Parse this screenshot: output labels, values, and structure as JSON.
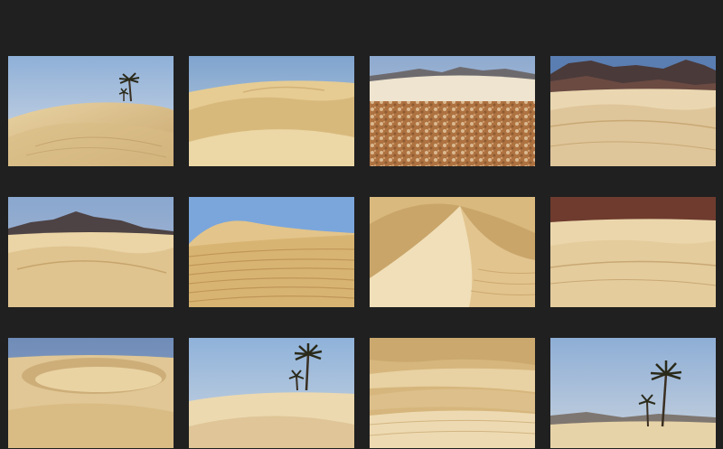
{
  "theme": {
    "background": "#202020"
  },
  "gallery": {
    "photos": [
      {
        "id": "p1",
        "scene": "dunes-with-palm-trees"
      },
      {
        "id": "p2",
        "scene": "sand-dunes"
      },
      {
        "id": "p3",
        "scene": "rocky-desert-with-mountains"
      },
      {
        "id": "p4",
        "scene": "dunes-before-dark-mountains"
      },
      {
        "id": "p5",
        "scene": "dunes-before-mountains"
      },
      {
        "id": "p6",
        "scene": "rippled-dune-crest"
      },
      {
        "id": "p7",
        "scene": "shaded-dune-ridge"
      },
      {
        "id": "p8",
        "scene": "dunes-below-red-cliff"
      },
      {
        "id": "p9",
        "scene": "dune-bowl"
      },
      {
        "id": "p10",
        "scene": "palm-trees-on-dune"
      },
      {
        "id": "p11",
        "scene": "layered-dunes"
      },
      {
        "id": "p12",
        "scene": "palm-trees-oasis"
      }
    ]
  }
}
